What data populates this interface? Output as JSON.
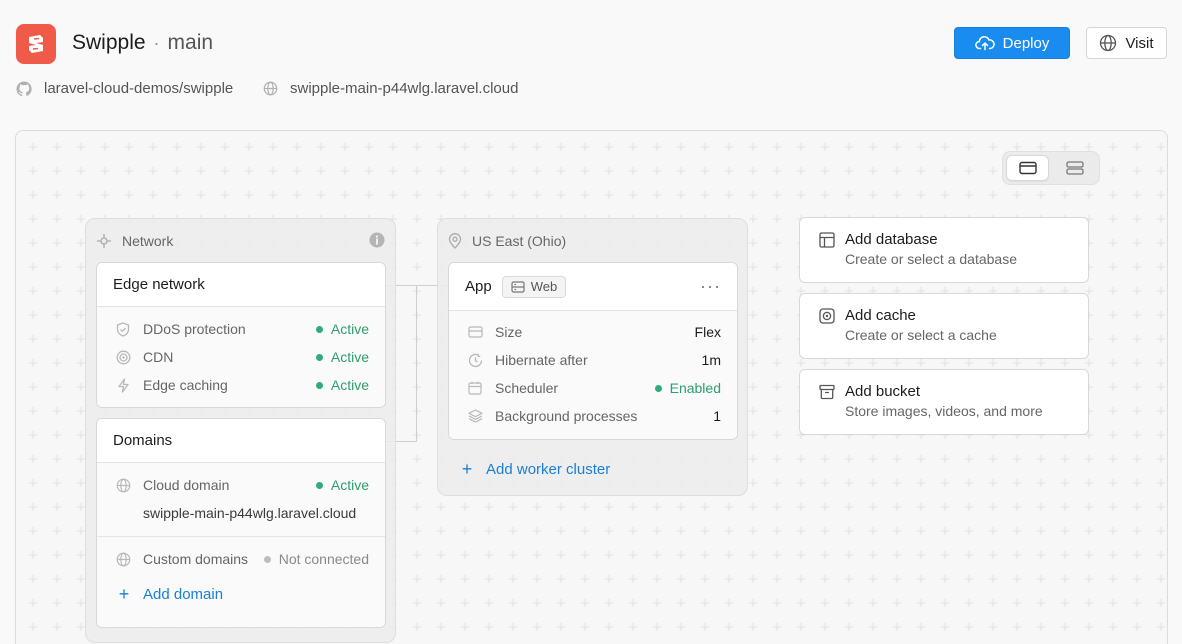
{
  "header": {
    "app_name": "Swipple",
    "separator": "·",
    "branch": "main",
    "deploy_label": "Deploy",
    "visit_label": "Visit",
    "repo": "laravel-cloud-demos/swipple",
    "domain": "swipple-main-p44wlg.laravel.cloud"
  },
  "colors": {
    "brand": "#f05a48",
    "primary": "#1a8cf0",
    "success": "#2ead7a",
    "link": "#1a7fd6"
  },
  "network": {
    "label": "Network",
    "edge": {
      "title": "Edge network",
      "rows": [
        {
          "label": "DDoS protection",
          "status": "Active",
          "icon": "shield-icon"
        },
        {
          "label": "CDN",
          "status": "Active",
          "icon": "cdn-icon"
        },
        {
          "label": "Edge caching",
          "status": "Active",
          "icon": "bolt-icon"
        }
      ]
    },
    "domains": {
      "title": "Domains",
      "cloud_label": "Cloud domain",
      "cloud_status": "Active",
      "cloud_value": "swipple-main-p44wlg.laravel.cloud",
      "custom_label": "Custom domains",
      "custom_status": "Not connected",
      "add_label": "Add domain"
    }
  },
  "region": {
    "label": "US East (Ohio)",
    "app": {
      "title": "App",
      "tag": "Web",
      "more": "···",
      "rows": [
        {
          "label": "Size",
          "value": "Flex",
          "icon": "size-icon"
        },
        {
          "label": "Hibernate after",
          "value": "1m",
          "icon": "clock-icon"
        },
        {
          "label": "Scheduler",
          "value": "Enabled",
          "icon": "calendar-icon"
        },
        {
          "label": "Background processes",
          "value": "1",
          "icon": "layers-icon"
        }
      ]
    },
    "add_worker_label": "Add worker cluster"
  },
  "resources": [
    {
      "title": "Add database",
      "subtitle": "Create or select a database",
      "icon": "database-icon"
    },
    {
      "title": "Add cache",
      "subtitle": "Create or select a cache",
      "icon": "cache-icon"
    },
    {
      "title": "Add bucket",
      "subtitle": "Store images, videos, and more",
      "icon": "bucket-icon"
    }
  ],
  "plus_glyph": "+"
}
